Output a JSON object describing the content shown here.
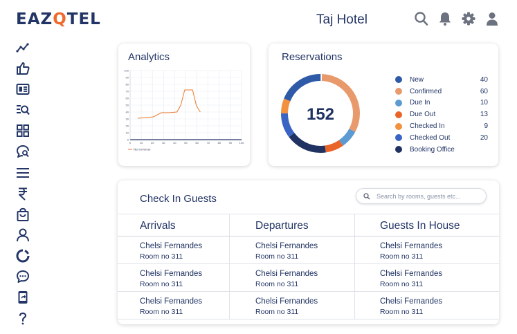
{
  "header": {
    "logo_prefix": "EAZ",
    "logo_pin": "Q",
    "logo_suffix": "TEL",
    "hotel_name": "Taj Hotel",
    "icons": [
      "search-icon",
      "bell-icon",
      "gear-icon",
      "user-icon"
    ]
  },
  "sidebar": {
    "items": [
      "trend-icon",
      "thumbs-up-icon",
      "newspaper-icon",
      "list-search-icon",
      "dashboard-grid-icon",
      "chat-search-icon",
      "menu-icon",
      "rupee-icon",
      "shopping-bag-icon",
      "person-icon",
      "refresh-icon",
      "chat-bubble-icon",
      "phone-share-icon",
      "help-icon"
    ]
  },
  "analytics": {
    "title": "Analytics",
    "chart_data": {
      "type": "line",
      "x": [
        10,
        20,
        30,
        40,
        50,
        60,
        65,
        70,
        75,
        80,
        85,
        90,
        100,
        110,
        120
      ],
      "series": [
        {
          "name": "Net revenue",
          "values": [
            31,
            32,
            33,
            39,
            39,
            40,
            50,
            72,
            72,
            72,
            49,
            40,
            40,
            40,
            40
          ]
        }
      ],
      "x_ticks": [
        0,
        10,
        20,
        30,
        40,
        50,
        60,
        70,
        80,
        90,
        100
      ],
      "y_ticks": [
        0,
        10,
        20,
        30,
        40,
        50,
        60,
        70,
        80,
        90,
        100
      ],
      "xlim": [
        0,
        100
      ],
      "ylim": [
        0,
        100
      ],
      "grid": true,
      "legend": "bottom-left"
    }
  },
  "reservations": {
    "title": "Reservations",
    "total": "152",
    "colors": {
      "new": "#2f5aa8",
      "confirmed": "#e89a6c",
      "due_in": "#5b9bd1",
      "due_out": "#ea6428",
      "checked_in": "#f2913e",
      "checked_out": "#3a64c4",
      "booking_office": "#1f3262"
    },
    "chart_data": {
      "type": "pie",
      "categories": [
        "New",
        "Confirmed",
        "Due In",
        "Due Out",
        "Checked In",
        "Checked Out",
        "Booking Office"
      ],
      "values": [
        40,
        60,
        10,
        13,
        9,
        20,
        null
      ]
    },
    "legend": [
      {
        "label": "New",
        "value": "40",
        "color": "#2f5aa8"
      },
      {
        "label": "Confirmed",
        "value": "60",
        "color": "#e89a6c"
      },
      {
        "label": "Due In",
        "value": "10",
        "color": "#5b9bd1"
      },
      {
        "label": "Due Out",
        "value": "13",
        "color": "#ea6428"
      },
      {
        "label": "Checked In",
        "value": "9",
        "color": "#f2913e"
      },
      {
        "label": "Checked Out",
        "value": "20",
        "color": "#3a64c4"
      },
      {
        "label": "Booking Office",
        "value": "",
        "color": "#1f3262"
      }
    ]
  },
  "checkin": {
    "title": "Check In Guests",
    "search_placeholder": "Search by rooms, guests etc...",
    "columns": [
      "Arrivals",
      "Departures",
      "Guests In House"
    ],
    "rows": [
      [
        {
          "name": "Chelsi Fernandes",
          "room": "Room no 311"
        },
        {
          "name": "Chelsi Fernandes",
          "room": "Room no 311"
        },
        {
          "name": "Chelsi Fernandes",
          "room": "Room no 311"
        }
      ],
      [
        {
          "name": "Chelsi Fernandes",
          "room": "Room no 311"
        },
        {
          "name": "Chelsi Fernandes",
          "room": "Room no 311"
        },
        {
          "name": "Chelsi Fernandes",
          "room": "Room no 311"
        }
      ],
      [
        {
          "name": "Chelsi Fernandes",
          "room": "Room no 311"
        },
        {
          "name": "Chelsi Fernandes",
          "room": "Room no 311"
        },
        {
          "name": "Chelsi Fernandes",
          "room": "Room no 311"
        }
      ]
    ]
  }
}
